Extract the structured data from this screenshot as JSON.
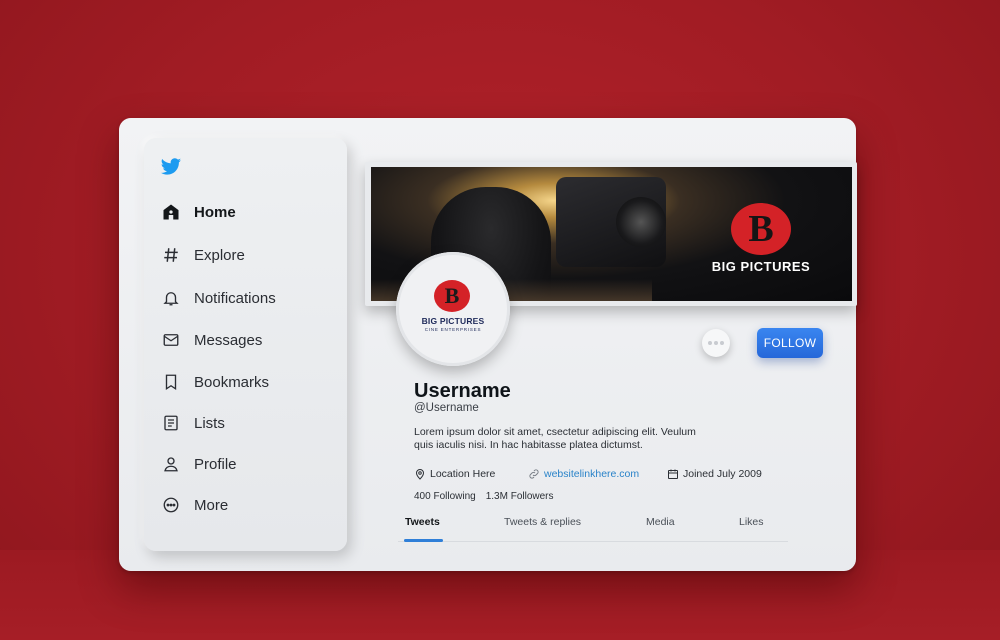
{
  "colors": {
    "background": "#a11c24",
    "accent": "#2f7fd8",
    "follow_button": "#2f72e3",
    "brand_red": "#d42227"
  },
  "sidebar": {
    "logo_icon": "bird-icon",
    "items": [
      {
        "label": "Home",
        "icon": "home-icon",
        "active": true
      },
      {
        "label": "Explore",
        "icon": "hashtag-icon",
        "active": false
      },
      {
        "label": "Notifications",
        "icon": "bell-icon",
        "active": false
      },
      {
        "label": "Messages",
        "icon": "envelope-icon",
        "active": false
      },
      {
        "label": "Bookmarks",
        "icon": "bookmark-icon",
        "active": false
      },
      {
        "label": "Lists",
        "icon": "list-icon",
        "active": false
      },
      {
        "label": "Profile",
        "icon": "person-icon",
        "active": false
      },
      {
        "label": "More",
        "icon": "more-circle-icon",
        "active": false
      }
    ]
  },
  "banner": {
    "brand_letter": "B",
    "brand_name": "BIG PICTURES"
  },
  "avatar": {
    "letter": "B",
    "title": "BIG PICTURES",
    "subtitle": "CINE ENTERPRISES"
  },
  "actions": {
    "follow_label": "FOLLOW"
  },
  "profile": {
    "name": "Username",
    "handle": "@Username",
    "bio": "Lorem ipsum dolor sit amet, csectetur adipiscing elit. Veulum quis iaculis nisi. In hac habitasse platea dictumst.",
    "location": "Location Here",
    "website": "websitelinkhere.com",
    "joined": "Joined July 2009",
    "following": "400 Following",
    "followers": "1.3M Followers"
  },
  "tabs": [
    {
      "label": "Tweets",
      "active": true
    },
    {
      "label": "Tweets & replies",
      "active": false
    },
    {
      "label": "Media",
      "active": false
    },
    {
      "label": "Likes",
      "active": false
    }
  ]
}
